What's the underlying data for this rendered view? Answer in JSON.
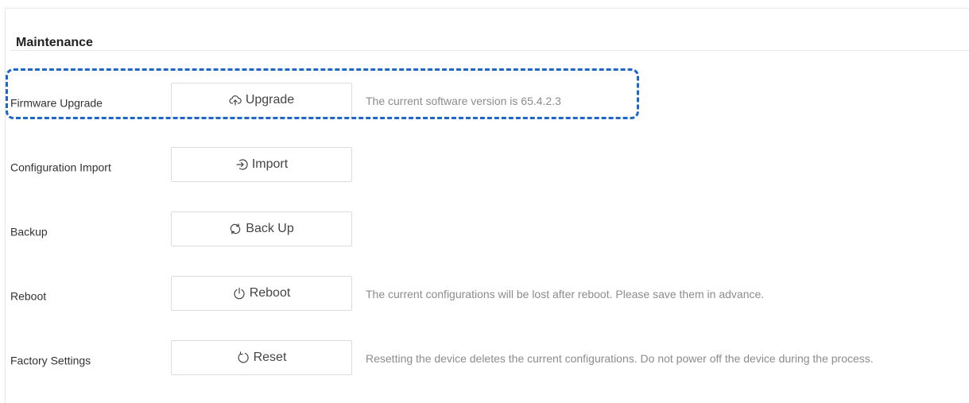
{
  "section": {
    "title": "Maintenance"
  },
  "rows": [
    {
      "label": "Firmware Upgrade",
      "button_label": "Upgrade",
      "button_icon": "cloud-upload-icon",
      "hint": "The current software version is 65.4.2.3"
    },
    {
      "label": "Configuration Import",
      "button_label": "Import",
      "button_icon": "import-icon",
      "hint": ""
    },
    {
      "label": "Backup",
      "button_label": "Back Up",
      "button_icon": "swap-arrows-icon",
      "hint": ""
    },
    {
      "label": "Reboot",
      "button_label": "Reboot",
      "button_icon": "power-icon",
      "hint": "The current configurations will be lost after reboot. Please save them in advance."
    },
    {
      "label": "Factory Settings",
      "button_label": "Reset",
      "button_icon": "reset-icon",
      "hint": "Resetting the device deletes the current configurations. Do not power off the device during the process."
    }
  ],
  "colors": {
    "highlight": "#1f66c9",
    "hint_text": "#8c8c8c",
    "button_border": "#dcdcdc"
  }
}
